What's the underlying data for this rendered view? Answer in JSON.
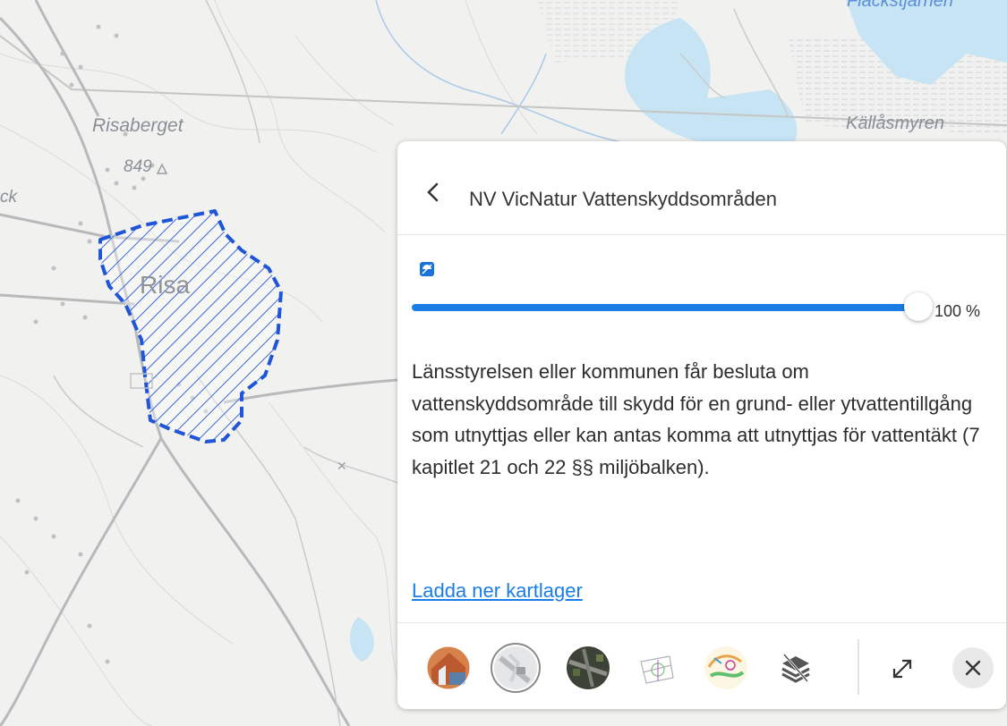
{
  "map": {
    "labels": {
      "risaberget": "Risaberget",
      "elevation": "849",
      "risa": "Risa",
      "kallasmyren": "Källåsmyren",
      "flackstjarnen": "Flackstjärnen",
      "ck": "ck"
    },
    "protected_area_color": "#1f55d6"
  },
  "panel": {
    "back_icon": "chevron-left-icon",
    "title": "NV VicNatur Vattenskyddsområden",
    "opacity_icon": "opacity-toggle-icon",
    "opacity_value": 1.0,
    "opacity_label": "100 %",
    "description": "Länsstyrelsen eller kommunen får besluta om vattenskyddsområde till skydd för en grund- eller ytvattentillgång som utnyttjas eller kan antas komma att utnyttjas för vattentäkt (7 kapitlet 21 och 22 §§ miljöbalken).",
    "download_link": "Ladda ner kartlager",
    "accent_color": "#1a7ee6"
  },
  "toolbar": {
    "basemaps": [
      {
        "name": "orthophoto-map",
        "selected": false
      },
      {
        "name": "topographic-map",
        "selected": true
      },
      {
        "name": "satellite-map",
        "selected": false
      },
      {
        "name": "property-map",
        "selected": false
      },
      {
        "name": "orienteering-map",
        "selected": false
      },
      {
        "name": "layers",
        "selected": false
      }
    ],
    "expand_icon": "expand-icon",
    "close_icon": "close-icon"
  }
}
